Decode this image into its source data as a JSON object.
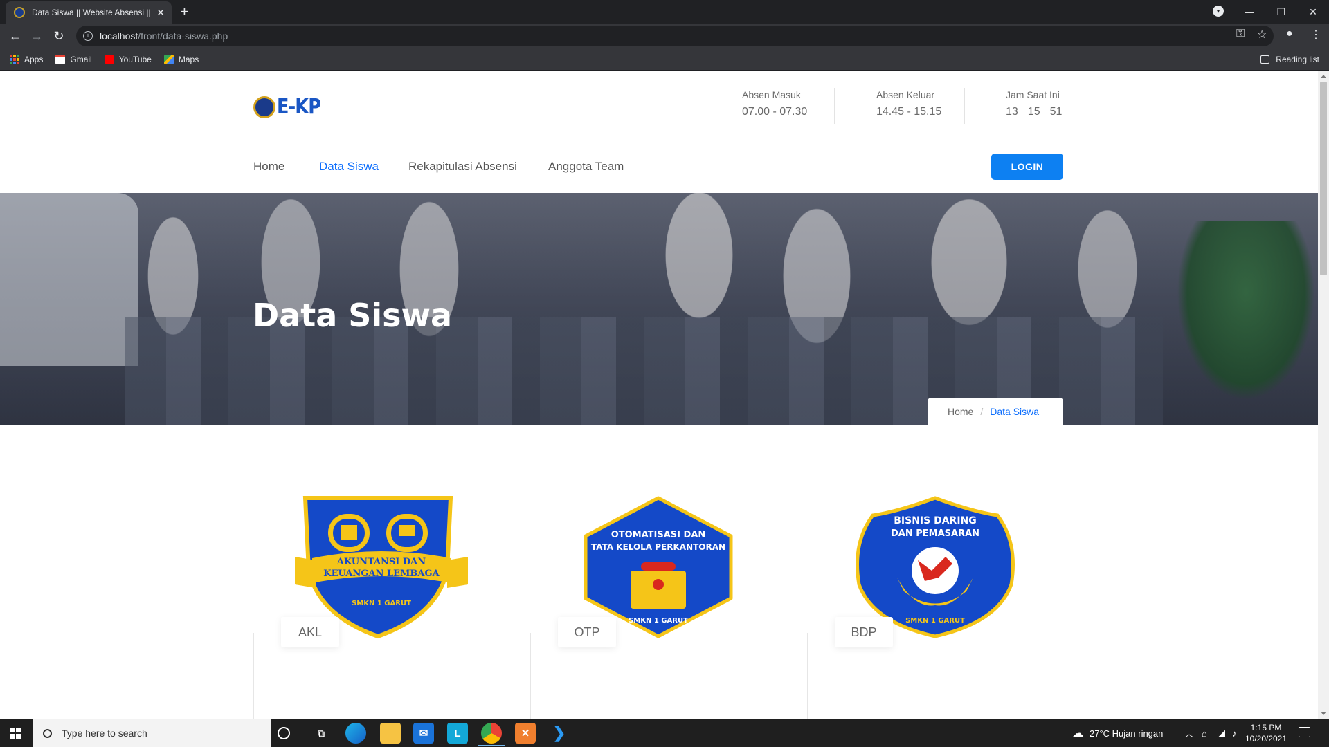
{
  "browser": {
    "tab_title": "Data Siswa || Website Absensi || S",
    "url_host": "localhost",
    "url_path": "/front/data-siswa.php",
    "bookmarks": [
      "Apps",
      "Gmail",
      "YouTube",
      "Maps"
    ],
    "reading_list": "Reading list"
  },
  "header": {
    "logo_text": "E-KP",
    "absen_masuk": {
      "label": "Absen Masuk",
      "value": "07.00 - 07.30"
    },
    "absen_keluar": {
      "label": "Absen Keluar",
      "value": "14.45 - 15.15"
    },
    "jam": {
      "label": "Jam Saat Ini",
      "hour": "13",
      "minute": "15",
      "second": "51"
    }
  },
  "nav": {
    "items": [
      "Home",
      "Data Siswa",
      "Rekapitulasi Absensi",
      "Anggota Team"
    ],
    "active": "Data Siswa",
    "login": "LOGIN"
  },
  "hero": {
    "title": "Data Siswa",
    "breadcrumb": {
      "home": "Home",
      "current": "Data Siswa"
    }
  },
  "cards": [
    {
      "code": "AKL",
      "badge_lines": [
        "AKUNTANSI DAN",
        "KEUANGAN LEMBAGA"
      ],
      "badge_footer": "SMKN 1 GARUT"
    },
    {
      "code": "OTP",
      "badge_lines": [
        "OTOMATISASI DAN",
        "TATA KELOLA PERKANTORAN"
      ],
      "badge_footer": "SMKN 1 GARUT"
    },
    {
      "code": "BDP",
      "badge_lines": [
        "BISNIS DARING",
        "DAN PEMASARAN"
      ],
      "badge_footer": "SMKN 1 GARUT"
    }
  ],
  "taskbar": {
    "search_placeholder": "Type here to search",
    "weather": "27°C  Hujan ringan",
    "time": "1:15 PM",
    "date": "10/20/2021"
  },
  "colors": {
    "accent": "#0d6efd",
    "badge_blue": "#1449c8",
    "badge_gold": "#f5c518"
  }
}
